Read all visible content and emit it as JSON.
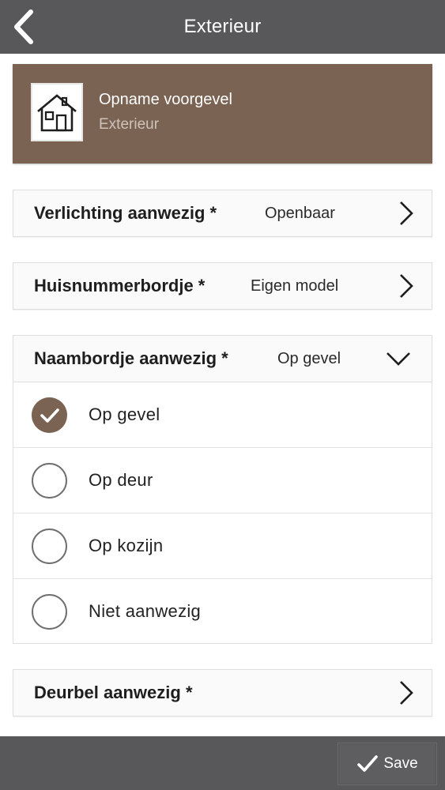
{
  "topbar": {
    "title": "Exterieur",
    "back_icon": "chevron-left-icon"
  },
  "header_card": {
    "icon": "house-icon",
    "title": "Opname voorgevel",
    "subtitle": "Exterieur",
    "background_color": "#7a6352"
  },
  "rows": [
    {
      "label": "Verlichting aanwezig *",
      "value": "Openbaar",
      "state": "collapsed"
    },
    {
      "label": "Huisnummerbordje *",
      "value": "Eigen model",
      "state": "collapsed"
    },
    {
      "label": "Naambordje aanwezig *",
      "value": "Op gevel",
      "state": "expanded"
    },
    {
      "label": "Deurbel aanwezig *",
      "value": "",
      "state": "collapsed"
    }
  ],
  "naambordje_options": [
    {
      "label": "Op gevel",
      "checked": true
    },
    {
      "label": "Op deur",
      "checked": false
    },
    {
      "label": "Op kozijn",
      "checked": false
    },
    {
      "label": "Niet aanwezig",
      "checked": false
    }
  ],
  "bottombar": {
    "save_label": "Save",
    "save_icon": "checkmark-icon"
  },
  "colors": {
    "bar": "#58585a",
    "accent": "#7a6352"
  }
}
